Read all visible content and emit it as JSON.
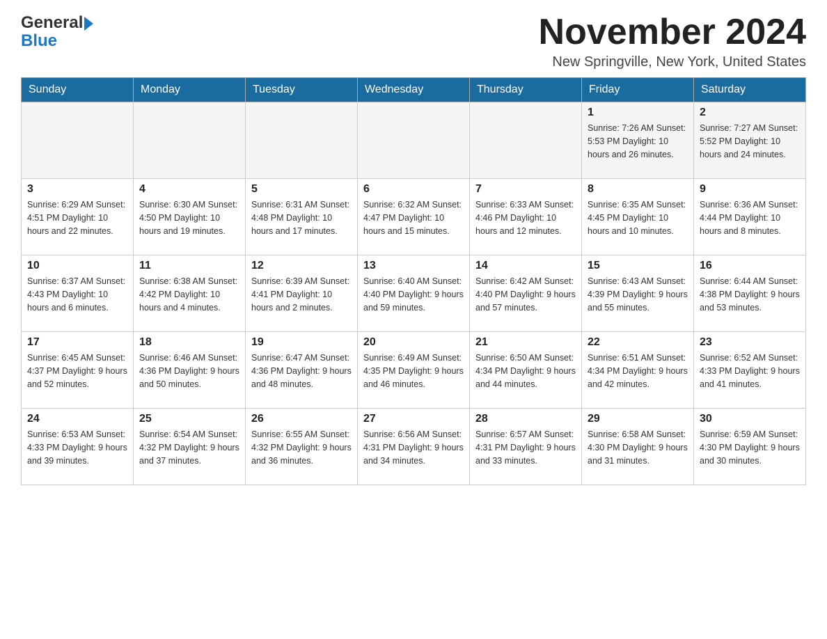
{
  "header": {
    "logo": {
      "general": "General",
      "blue": "Blue",
      "arrow": "▶"
    },
    "title": "November 2024",
    "location": "New Springville, New York, United States"
  },
  "weekdays": [
    "Sunday",
    "Monday",
    "Tuesday",
    "Wednesday",
    "Thursday",
    "Friday",
    "Saturday"
  ],
  "weeks": [
    [
      {
        "day": "",
        "info": ""
      },
      {
        "day": "",
        "info": ""
      },
      {
        "day": "",
        "info": ""
      },
      {
        "day": "",
        "info": ""
      },
      {
        "day": "",
        "info": ""
      },
      {
        "day": "1",
        "info": "Sunrise: 7:26 AM\nSunset: 5:53 PM\nDaylight: 10 hours and 26 minutes."
      },
      {
        "day": "2",
        "info": "Sunrise: 7:27 AM\nSunset: 5:52 PM\nDaylight: 10 hours and 24 minutes."
      }
    ],
    [
      {
        "day": "3",
        "info": "Sunrise: 6:29 AM\nSunset: 4:51 PM\nDaylight: 10 hours and 22 minutes."
      },
      {
        "day": "4",
        "info": "Sunrise: 6:30 AM\nSunset: 4:50 PM\nDaylight: 10 hours and 19 minutes."
      },
      {
        "day": "5",
        "info": "Sunrise: 6:31 AM\nSunset: 4:48 PM\nDaylight: 10 hours and 17 minutes."
      },
      {
        "day": "6",
        "info": "Sunrise: 6:32 AM\nSunset: 4:47 PM\nDaylight: 10 hours and 15 minutes."
      },
      {
        "day": "7",
        "info": "Sunrise: 6:33 AM\nSunset: 4:46 PM\nDaylight: 10 hours and 12 minutes."
      },
      {
        "day": "8",
        "info": "Sunrise: 6:35 AM\nSunset: 4:45 PM\nDaylight: 10 hours and 10 minutes."
      },
      {
        "day": "9",
        "info": "Sunrise: 6:36 AM\nSunset: 4:44 PM\nDaylight: 10 hours and 8 minutes."
      }
    ],
    [
      {
        "day": "10",
        "info": "Sunrise: 6:37 AM\nSunset: 4:43 PM\nDaylight: 10 hours and 6 minutes."
      },
      {
        "day": "11",
        "info": "Sunrise: 6:38 AM\nSunset: 4:42 PM\nDaylight: 10 hours and 4 minutes."
      },
      {
        "day": "12",
        "info": "Sunrise: 6:39 AM\nSunset: 4:41 PM\nDaylight: 10 hours and 2 minutes."
      },
      {
        "day": "13",
        "info": "Sunrise: 6:40 AM\nSunset: 4:40 PM\nDaylight: 9 hours and 59 minutes."
      },
      {
        "day": "14",
        "info": "Sunrise: 6:42 AM\nSunset: 4:40 PM\nDaylight: 9 hours and 57 minutes."
      },
      {
        "day": "15",
        "info": "Sunrise: 6:43 AM\nSunset: 4:39 PM\nDaylight: 9 hours and 55 minutes."
      },
      {
        "day": "16",
        "info": "Sunrise: 6:44 AM\nSunset: 4:38 PM\nDaylight: 9 hours and 53 minutes."
      }
    ],
    [
      {
        "day": "17",
        "info": "Sunrise: 6:45 AM\nSunset: 4:37 PM\nDaylight: 9 hours and 52 minutes."
      },
      {
        "day": "18",
        "info": "Sunrise: 6:46 AM\nSunset: 4:36 PM\nDaylight: 9 hours and 50 minutes."
      },
      {
        "day": "19",
        "info": "Sunrise: 6:47 AM\nSunset: 4:36 PM\nDaylight: 9 hours and 48 minutes."
      },
      {
        "day": "20",
        "info": "Sunrise: 6:49 AM\nSunset: 4:35 PM\nDaylight: 9 hours and 46 minutes."
      },
      {
        "day": "21",
        "info": "Sunrise: 6:50 AM\nSunset: 4:34 PM\nDaylight: 9 hours and 44 minutes."
      },
      {
        "day": "22",
        "info": "Sunrise: 6:51 AM\nSunset: 4:34 PM\nDaylight: 9 hours and 42 minutes."
      },
      {
        "day": "23",
        "info": "Sunrise: 6:52 AM\nSunset: 4:33 PM\nDaylight: 9 hours and 41 minutes."
      }
    ],
    [
      {
        "day": "24",
        "info": "Sunrise: 6:53 AM\nSunset: 4:33 PM\nDaylight: 9 hours and 39 minutes."
      },
      {
        "day": "25",
        "info": "Sunrise: 6:54 AM\nSunset: 4:32 PM\nDaylight: 9 hours and 37 minutes."
      },
      {
        "day": "26",
        "info": "Sunrise: 6:55 AM\nSunset: 4:32 PM\nDaylight: 9 hours and 36 minutes."
      },
      {
        "day": "27",
        "info": "Sunrise: 6:56 AM\nSunset: 4:31 PM\nDaylight: 9 hours and 34 minutes."
      },
      {
        "day": "28",
        "info": "Sunrise: 6:57 AM\nSunset: 4:31 PM\nDaylight: 9 hours and 33 minutes."
      },
      {
        "day": "29",
        "info": "Sunrise: 6:58 AM\nSunset: 4:30 PM\nDaylight: 9 hours and 31 minutes."
      },
      {
        "day": "30",
        "info": "Sunrise: 6:59 AM\nSunset: 4:30 PM\nDaylight: 9 hours and 30 minutes."
      }
    ]
  ]
}
